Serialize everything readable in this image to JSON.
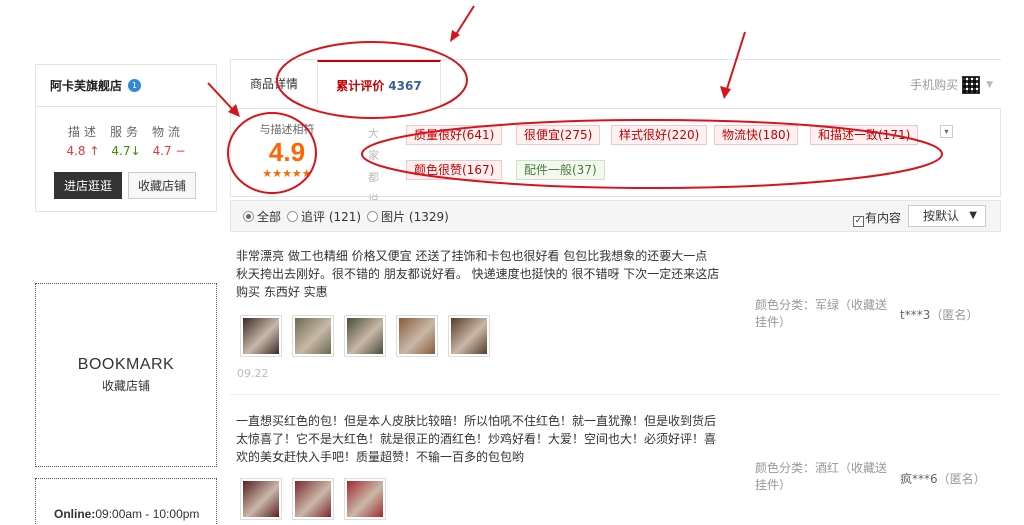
{
  "store": {
    "name": "阿卡芙旗舰店",
    "badge": "1",
    "dsr_labels": [
      "描述",
      "服务",
      "物流"
    ],
    "dsr_values": [
      {
        "value": "4.8",
        "arrow": "↑"
      },
      {
        "value": "4.7",
        "arrow": "↓"
      },
      {
        "value": "4.7",
        "arrow": "−"
      }
    ],
    "enter_label": "进店逛逛",
    "fav_label": "收藏店铺"
  },
  "bookmark": {
    "title": "BOOKMARK",
    "subtitle": "收藏店铺"
  },
  "online": {
    "label": "Online:",
    "hours": "09:00am - 10:00pm"
  },
  "tabs": {
    "detail": "商品详情",
    "reviews": "累计评价",
    "reviews_count": "4367",
    "mobile_buy": "手机购买"
  },
  "rating": {
    "label": "与描述相符",
    "score": "4.9",
    "stars": "★★★★★",
    "side_label": [
      "大",
      "家",
      "都",
      "说"
    ]
  },
  "tags": [
    {
      "text": "质量很好(641)",
      "kind": "positive"
    },
    {
      "text": "很便宜(275)",
      "kind": "positive"
    },
    {
      "text": "样式很好(220)",
      "kind": "positive"
    },
    {
      "text": "物流快(180)",
      "kind": "positive"
    },
    {
      "text": "和描述一致(171)",
      "kind": "positive"
    },
    {
      "text": "颜色很赞(167)",
      "kind": "positive"
    },
    {
      "text": "配件一般(37)",
      "kind": "neutral"
    }
  ],
  "filter": {
    "all": "全部",
    "followup": "追评 (121)",
    "images": "图片 (1329)",
    "has_content": "有内容",
    "sort": "按默认"
  },
  "reviews": [
    {
      "text": "非常漂亮 做工也精细 价格又便宜 还送了挂饰和卡包也很好看 包包比我想象的还要大一点 秋天挎出去刚好。很不错的 朋友都说好看。 快递速度也挺快的 很不错呀 下次一定还来这店购买 东西好 实惠",
      "date": "09.22",
      "sku": "颜色分类：军绿（收藏送挂件）",
      "user": "t***3",
      "anon": "（匿名）",
      "thumb_colors": [
        "#3b2a2a",
        "#6b6a4e",
        "#4a4a3a",
        "#8a5a3a",
        "#5a3a2a"
      ]
    },
    {
      "text": "一直想买红色的包！但是本人皮肤比较暗！所以怕吼不住红色！就一直犹豫！但是收到货后太惊喜了！它不是大红色！就是很正的酒红色！炒鸡好看！大爱！空间也大！必须好评！喜欢的美女赶快入手吧！质量超赞！不输一百多的包包哟",
      "date": "",
      "sku": "颜色分类：酒红（收藏送挂件）",
      "user": "疯***6",
      "anon": "（匿名）",
      "thumb_colors": [
        "#5a1f22",
        "#7a2a2e",
        "#a02a30"
      ]
    }
  ],
  "colors": {
    "accent": "#c40000",
    "score": "#ff6600",
    "annotation": "#d8131b"
  }
}
